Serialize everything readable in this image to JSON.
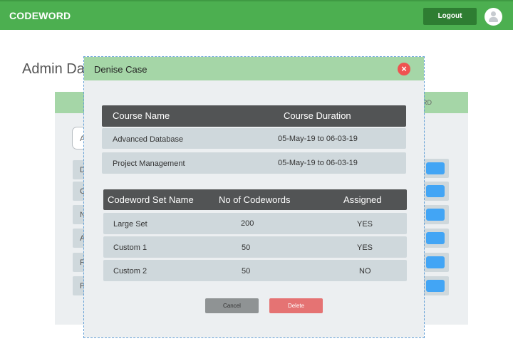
{
  "app": {
    "brand": "CODEWORD",
    "logout_label": "Logout"
  },
  "page": {
    "title": "Admin Da",
    "panel_header_fragment": "RD",
    "search_fragment": "A",
    "row_fragments": [
      "D",
      "C",
      "N",
      "A",
      "F",
      "F"
    ]
  },
  "modal": {
    "title": "Denise Case",
    "close_icon": "close-icon",
    "courses": {
      "headers": [
        "Course Name",
        "Course Duration"
      ],
      "rows": [
        {
          "name": "Advanced Database",
          "duration": "05-May-19 to 06-03-19"
        },
        {
          "name": "Project Management",
          "duration": "05-May-19 to 06-03-19"
        }
      ]
    },
    "codewords": {
      "headers": [
        "Codeword Set Name",
        "No of Codewords",
        "Assigned"
      ],
      "rows": [
        {
          "name": "Large Set",
          "count": "200",
          "assigned": "YES"
        },
        {
          "name": "Custom 1",
          "count": "50",
          "assigned": "YES"
        },
        {
          "name": "Custom 2",
          "count": "50",
          "assigned": "NO"
        }
      ]
    },
    "cancel_label": "Cancel",
    "delete_label": "Delete"
  },
  "colors": {
    "topbar": "#4caf50",
    "header_green": "#a5d6a7",
    "table_header": "#525455",
    "row_bg": "#cfd8dc",
    "close": "#ef5350",
    "delete": "#e57373",
    "cancel": "#8f9394"
  }
}
